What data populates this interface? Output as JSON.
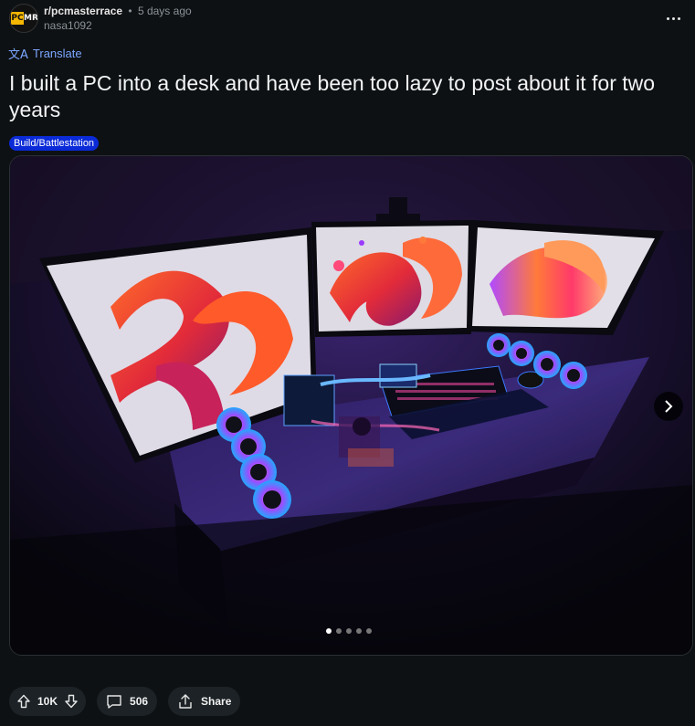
{
  "post": {
    "subreddit": "r/pcmasterrace",
    "separator": "•",
    "time_ago": "5 days ago",
    "author": "nasa1092",
    "avatar_left": "PC",
    "avatar_right": "MR",
    "translate_label": "Translate",
    "title": "I built a PC into a desk and have been too lazy to post about it for two years",
    "flair": "Build/Battlestation"
  },
  "gallery": {
    "current_index": 1,
    "total_images": 5
  },
  "actions": {
    "score": "10K",
    "comments": "506",
    "share_label": "Share"
  },
  "colors": {
    "background": "#0e1113",
    "accent_link": "#7ba6ff",
    "flair_bg": "#0b2bd8",
    "pill_bg": "#1c2226"
  }
}
